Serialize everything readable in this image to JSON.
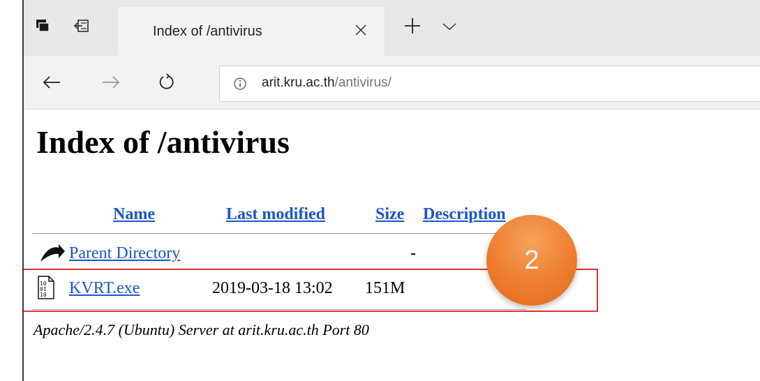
{
  "browser": {
    "tab": {
      "title": "Index of /antivirus"
    },
    "address": {
      "host": "arit.kru.ac.th",
      "path": "/antivirus/"
    }
  },
  "page": {
    "heading": "Index of /antivirus",
    "columns": {
      "name": "Name",
      "last_modified": "Last modified",
      "size": "Size",
      "description": "Description"
    },
    "rows": [
      {
        "name": "Parent Directory",
        "last_modified": "",
        "size": "-",
        "icon": "back-arrow-icon"
      },
      {
        "name": "KVRT.exe",
        "last_modified": "2019-03-18 13:02",
        "size": "151M",
        "icon": "binary-file-icon"
      }
    ],
    "footer": "Apache/2.4.7 (Ubuntu) Server at arit.kru.ac.th Port 80"
  },
  "annotation": {
    "step_number": "2",
    "highlight_color": "#e33333",
    "badge_color": "#ee7e2e"
  }
}
